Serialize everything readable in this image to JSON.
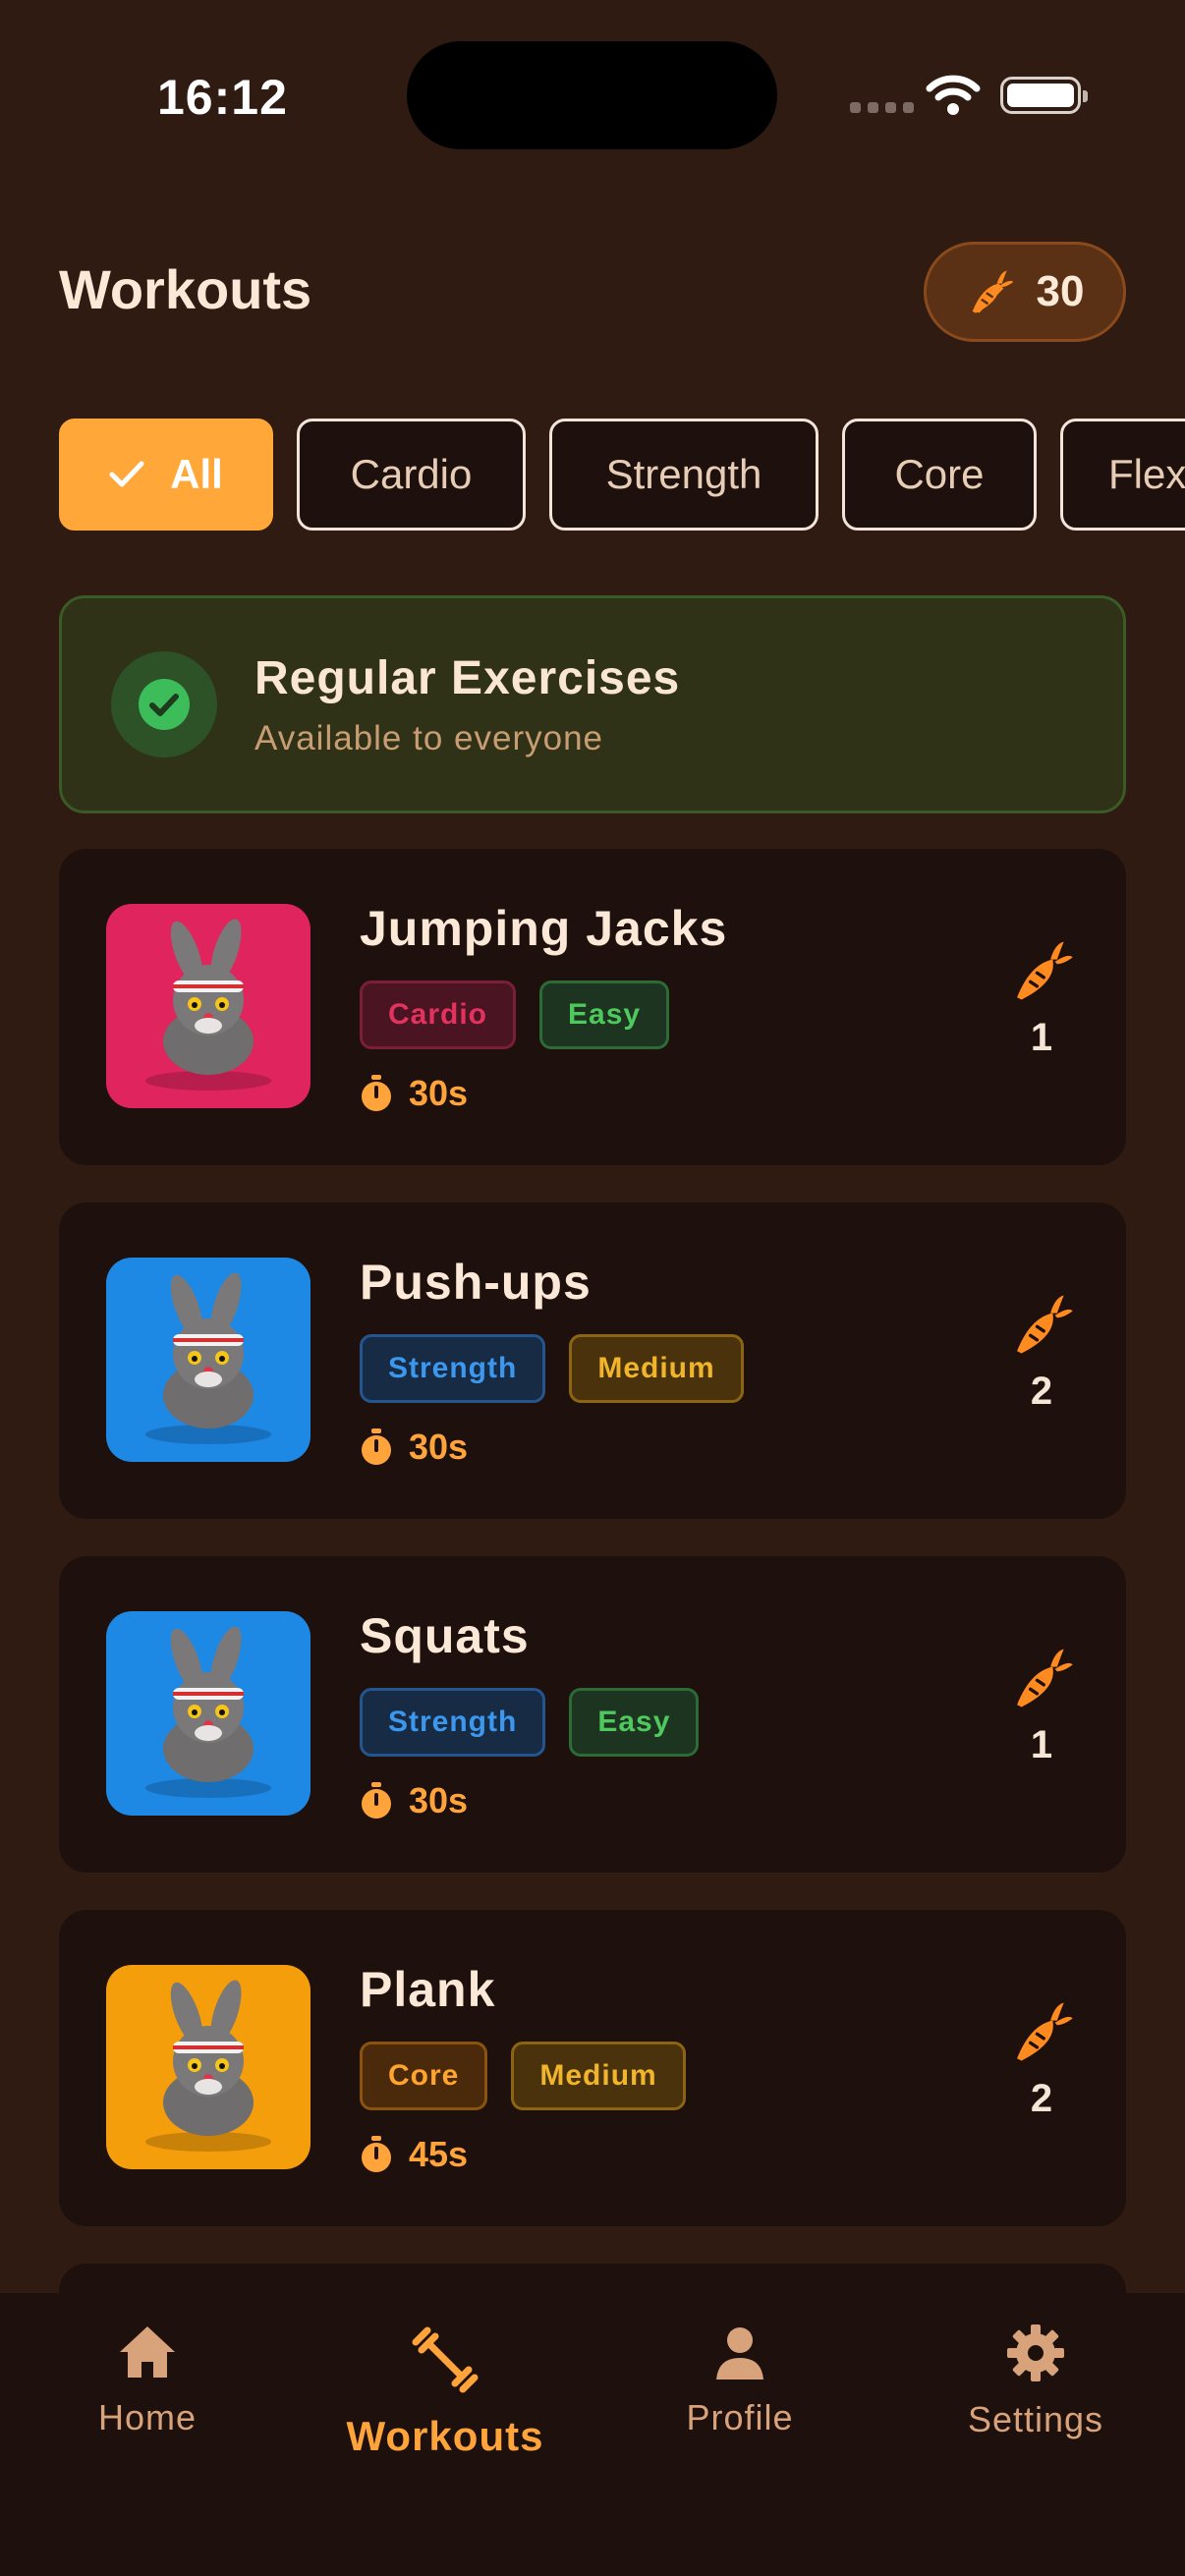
{
  "status_bar": {
    "time": "16:12"
  },
  "header": {
    "title": "Workouts",
    "carrot_count": "30"
  },
  "filters": [
    "All",
    "Cardio",
    "Strength",
    "Core",
    "Flexibility"
  ],
  "banner": {
    "title": "Regular Exercises",
    "subtitle": "Available to everyone"
  },
  "workouts": [
    {
      "name": "Jumping Jacks",
      "category": "Cardio",
      "difficulty": "Easy",
      "duration": "30s",
      "reward": "1",
      "thumb_color": "#e0245e"
    },
    {
      "name": "Push-ups",
      "category": "Strength",
      "difficulty": "Medium",
      "duration": "30s",
      "reward": "2",
      "thumb_color": "#1e88e5"
    },
    {
      "name": "Squats",
      "category": "Strength",
      "difficulty": "Easy",
      "duration": "30s",
      "reward": "1",
      "thumb_color": "#1e88e5"
    },
    {
      "name": "Plank",
      "category": "Core",
      "difficulty": "Medium",
      "duration": "45s",
      "reward": "2",
      "thumb_color": "#f59e0b"
    }
  ],
  "tabbar": [
    {
      "label": "Home",
      "icon": "home-icon"
    },
    {
      "label": "Workouts",
      "icon": "dumbbell-icon",
      "active": true
    },
    {
      "label": "Profile",
      "icon": "person-icon"
    },
    {
      "label": "Settings",
      "icon": "gear-icon"
    }
  ],
  "colors": {
    "accent": "#ffa738",
    "background": "#2f1b12",
    "card": "#1e100c"
  }
}
